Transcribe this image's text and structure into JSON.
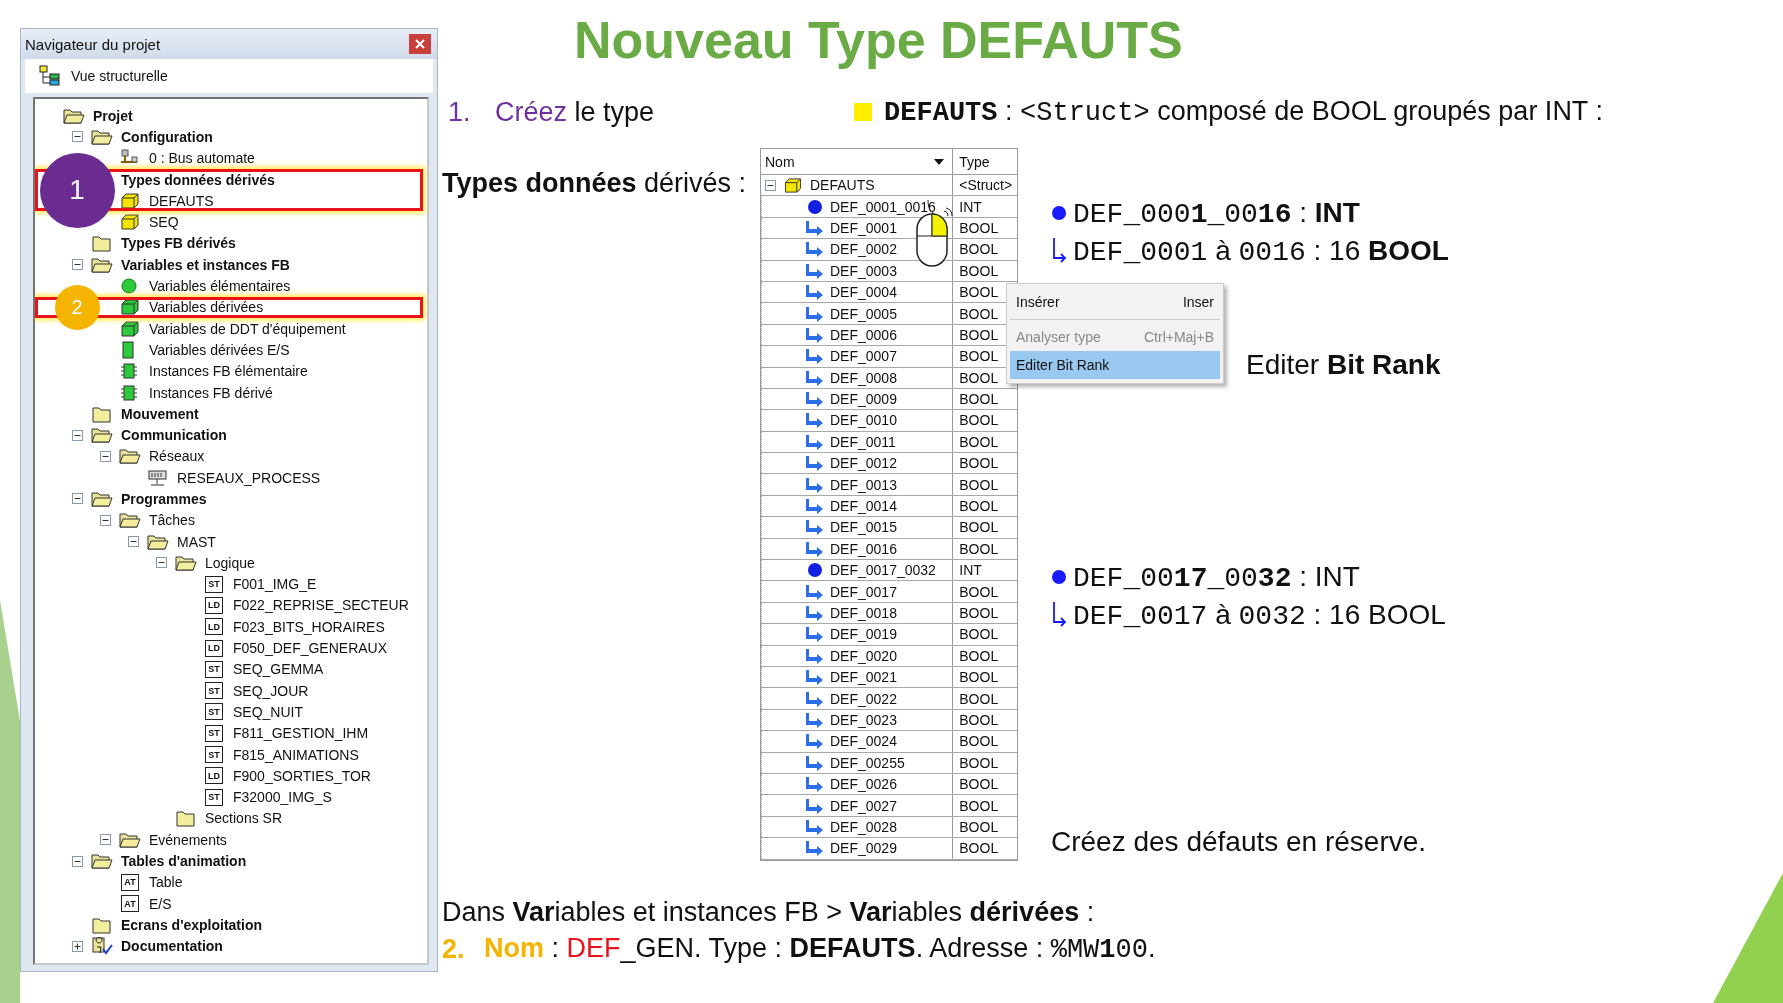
{
  "title": "Nouveau Type DEFAUTS",
  "navigator": {
    "title": "Navigateur du projet",
    "view_label": "Vue structurelle",
    "tree": [
      {
        "label": "Projet",
        "kind": "folder-open",
        "highlighted": false,
        "children": [
          {
            "label": "Configuration",
            "kind": "folder-open",
            "highlighted": false,
            "expanded": true,
            "children": [
              {
                "label": "0 : Bus automate",
                "kind": "bus",
                "highlighted": false
              }
            ]
          },
          {
            "label": "Types données dérivés",
            "highlighted": true,
            "children": [
              {
                "label": "DEFAUTS",
                "kind": "cube-yellow",
                "highlighted": true
              },
              {
                "label": "SEQ",
                "kind": "cube-yellow",
                "highlighted": false
              }
            ]
          },
          {
            "label": "Types FB dérivés",
            "kind": "folder",
            "highlighted": false
          },
          {
            "label": "Variables et instances FB",
            "kind": "folder-open",
            "highlighted": false,
            "expanded": true,
            "children": [
              {
                "label": "Variables élémentaires",
                "kind": "ball-green",
                "highlighted": false
              },
              {
                "label": "Variables dérivées",
                "kind": "cube-green",
                "highlighted": true
              },
              {
                "label": "Variables de DDT d'équipement",
                "kind": "cube-green",
                "highlighted": false
              },
              {
                "label": "Variables dérivées E/S",
                "kind": "block-green",
                "highlighted": false
              },
              {
                "label": "Instances FB élémentaire",
                "kind": "chip-green",
                "highlighted": false
              },
              {
                "label": "Instances FB dérivé",
                "kind": "chip-green",
                "highlighted": false
              }
            ]
          },
          {
            "label": "Mouvement",
            "kind": "folder",
            "highlighted": false
          },
          {
            "label": "Communication",
            "kind": "folder-open",
            "highlighted": false,
            "expanded": true,
            "children": [
              {
                "label": "Réseaux",
                "kind": "folder-open",
                "highlighted": false,
                "expanded": true,
                "children": [
                  {
                    "label": "RESEAUX_PROCESS",
                    "kind": "network",
                    "highlighted": false
                  }
                ]
              }
            ]
          },
          {
            "label": "Programmes",
            "kind": "folder-open",
            "highlighted": false,
            "expanded": true,
            "children": [
              {
                "label": "Tâches",
                "kind": "folder-open",
                "highlighted": false,
                "expanded": true,
                "children": [
                  {
                    "label": "MAST",
                    "kind": "folder-open",
                    "highlighted": false,
                    "expanded": true,
                    "children": [
                      {
                        "label": "Logique",
                        "kind": "folder-open",
                        "highlighted": false,
                        "expanded": true,
                        "children": [
                          {
                            "label": "F001_IMG_E",
                            "kind": "section",
                            "badge": "ST",
                            "highlighted": false
                          },
                          {
                            "label": "F022_REPRISE_SECTEUR",
                            "kind": "section",
                            "badge": "LD",
                            "highlighted": false
                          },
                          {
                            "label": "F023_BITS_HORAIRES",
                            "kind": "section",
                            "badge": "LD",
                            "highlighted": false
                          },
                          {
                            "label": "F050_DEF_GENERAUX",
                            "kind": "section",
                            "badge": "LD",
                            "highlighted": false
                          },
                          {
                            "label": "SEQ_GEMMA",
                            "kind": "section",
                            "badge": "ST",
                            "highlighted": false
                          },
                          {
                            "label": "SEQ_JOUR",
                            "kind": "section",
                            "badge": "ST",
                            "highlighted": false
                          },
                          {
                            "label": "SEQ_NUIT",
                            "kind": "section",
                            "badge": "ST",
                            "highlighted": false
                          },
                          {
                            "label": "F811_GESTION_IHM",
                            "kind": "section",
                            "badge": "ST",
                            "highlighted": false
                          },
                          {
                            "label": "F815_ANIMATIONS",
                            "kind": "section",
                            "badge": "ST",
                            "highlighted": false
                          },
                          {
                            "label": "F900_SORTIES_TOR",
                            "kind": "section",
                            "badge": "LD",
                            "highlighted": false
                          },
                          {
                            "label": "F32000_IMG_S",
                            "kind": "section",
                            "badge": "ST",
                            "highlighted": false
                          }
                        ]
                      },
                      {
                        "label": "Sections SR",
                        "kind": "folder",
                        "highlighted": false
                      }
                    ]
                  }
                ]
              },
              {
                "label": "Evénements",
                "kind": "folder-open",
                "highlighted": false,
                "expanded": true
              }
            ]
          },
          {
            "label": "Tables d'animation",
            "kind": "folder-open",
            "highlighted": false,
            "expanded": true,
            "children": [
              {
                "label": "Table",
                "kind": "section",
                "badge": "AT",
                "highlighted": false
              },
              {
                "label": "E/S",
                "kind": "section",
                "badge": "AT",
                "highlighted": false
              }
            ]
          },
          {
            "label": "Ecrans d'exploitation",
            "kind": "folder",
            "highlighted": false
          },
          {
            "label": "Documentation",
            "kind": "book",
            "highlighted": false,
            "expanded": false
          }
        ]
      }
    ],
    "callouts": [
      {
        "number": "1",
        "color": "#6a2c91"
      },
      {
        "number": "2",
        "color": "#f5b400"
      }
    ]
  },
  "step_1": {
    "number": {
      "text": "1.",
      "kind": "accent"
    },
    "segments": [
      {
        "text": "Créez",
        "kind": "accent"
      },
      {
        "text": " le type",
        "kind": "plain"
      }
    ]
  },
  "type_heading": [
    {
      "text": "DEFAUTS",
      "kind": "monobold"
    },
    {
      "text": " : ",
      "kind": "plain"
    },
    {
      "text": "<Struct>",
      "kind": "mono"
    },
    {
      "text": " composé de BOOL groupés par INT :",
      "kind": "plain"
    }
  ],
  "section_label": [
    {
      "text": "Types données",
      "kind": "bold"
    },
    {
      "text": " dérivés :",
      "kind": "plain"
    }
  ],
  "ddt_table": {
    "columns": [
      "Nom",
      "Type"
    ],
    "root": {
      "name": "DEFAUTS",
      "type": "<Struct>",
      "expanded": true
    },
    "rows": [
      {
        "kind": "int",
        "name": "DEF_0001_0016",
        "type": "INT"
      },
      {
        "kind": "bool",
        "name": "DEF_0001",
        "type": "BOOL"
      },
      {
        "kind": "bool",
        "name": "DEF_0002",
        "type": "BOOL"
      },
      {
        "kind": "bool",
        "name": "DEF_0003",
        "type": "BOOL"
      },
      {
        "kind": "bool",
        "name": "DEF_0004",
        "type": "BOOL"
      },
      {
        "kind": "bool",
        "name": "DEF_0005",
        "type": "BOOL"
      },
      {
        "kind": "bool",
        "name": "DEF_0006",
        "type": "BOOL"
      },
      {
        "kind": "bool",
        "name": "DEF_0007",
        "type": "BOOL"
      },
      {
        "kind": "bool",
        "name": "DEF_0008",
        "type": "BOOL"
      },
      {
        "kind": "bool",
        "name": "DEF_0009",
        "type": "BOOL"
      },
      {
        "kind": "bool",
        "name": "DEF_0010",
        "type": "BOOL"
      },
      {
        "kind": "bool",
        "name": "DEF_0011",
        "type": "BOOL"
      },
      {
        "kind": "bool",
        "name": "DEF_0012",
        "type": "BOOL"
      },
      {
        "kind": "bool",
        "name": "DEF_0013",
        "type": "BOOL"
      },
      {
        "kind": "bool",
        "name": "DEF_0014",
        "type": "BOOL"
      },
      {
        "kind": "bool",
        "name": "DEF_0015",
        "type": "BOOL"
      },
      {
        "kind": "bool",
        "name": "DEF_0016",
        "type": "BOOL"
      },
      {
        "kind": "int",
        "name": "DEF_0017_0032",
        "type": "INT"
      },
      {
        "kind": "bool",
        "name": "DEF_0017",
        "type": "BOOL"
      },
      {
        "kind": "bool",
        "name": "DEF_0018",
        "type": "BOOL"
      },
      {
        "kind": "bool",
        "name": "DEF_0019",
        "type": "BOOL"
      },
      {
        "kind": "bool",
        "name": "DEF_0020",
        "type": "BOOL"
      },
      {
        "kind": "bool",
        "name": "DEF_0021",
        "type": "BOOL"
      },
      {
        "kind": "bool",
        "name": "DEF_0022",
        "type": "BOOL"
      },
      {
        "kind": "bool",
        "name": "DEF_0023",
        "type": "BOOL"
      },
      {
        "kind": "bool",
        "name": "DEF_0024",
        "type": "BOOL"
      },
      {
        "kind": "bool",
        "name": "DEF_00255",
        "type": "BOOL"
      },
      {
        "kind": "bool",
        "name": "DEF_0026",
        "type": "BOOL"
      },
      {
        "kind": "bool",
        "name": "DEF_0027",
        "type": "BOOL"
      },
      {
        "kind": "bool",
        "name": "DEF_0028",
        "type": "BOOL"
      },
      {
        "kind": "bool",
        "name": "DEF_0029",
        "type": "BOOL"
      }
    ]
  },
  "context_menu": [
    {
      "label": "Insérer",
      "shortcut": "Inser",
      "disabled": false,
      "selected": false,
      "separator_after": true
    },
    {
      "label": "Analyser type",
      "shortcut": "Ctrl+Maj+B",
      "disabled": true,
      "selected": false,
      "separator_after": false
    },
    {
      "label": "Editer Bit Rank",
      "disabled": false,
      "selected": true,
      "separator_after": false
    }
  ],
  "notes_first": [
    {
      "kind": "dot",
      "segments": [
        {
          "text": "DEF_000",
          "kind": "mono"
        },
        {
          "text": "1",
          "kind": "monobold"
        },
        {
          "text": "_00",
          "kind": "mono"
        },
        {
          "text": "16",
          "kind": "monobold"
        },
        {
          "text": " : ",
          "kind": "plain"
        },
        {
          "text": "INT",
          "kind": "bold"
        }
      ]
    },
    {
      "kind": "arrow",
      "segments": [
        {
          "text": "DEF_0001",
          "kind": "mono"
        },
        {
          "text": " à ",
          "kind": "plain"
        },
        {
          "text": "0016",
          "kind": "mono"
        },
        {
          "text": " : 16 ",
          "kind": "plain"
        },
        {
          "text": "BOOL",
          "kind": "bold"
        }
      ]
    }
  ],
  "menu_hint": [
    {
      "text": "Editer ",
      "kind": "plain"
    },
    {
      "text": "Bit Rank",
      "kind": "bold"
    }
  ],
  "notes_second": [
    {
      "kind": "dot",
      "segments": [
        {
          "text": "DEF_00",
          "kind": "mono"
        },
        {
          "text": "17",
          "kind": "monobold"
        },
        {
          "text": "_00",
          "kind": "mono"
        },
        {
          "text": "32",
          "kind": "monobold"
        },
        {
          "text": " : INT",
          "kind": "plain"
        }
      ]
    },
    {
      "kind": "arrow",
      "segments": [
        {
          "text": "DEF_0017",
          "kind": "mono"
        },
        {
          "text": " à ",
          "kind": "plain"
        },
        {
          "text": "0032",
          "kind": "mono"
        },
        {
          "text": " : 16 BOOL",
          "kind": "plain"
        }
      ]
    }
  ],
  "reserve_note": [
    {
      "text": "Créez des défauts en réserve.",
      "kind": "plain"
    }
  ],
  "footer_lines": [
    {
      "segments": [
        {
          "text": "Dans ",
          "kind": "plain"
        },
        {
          "text": "Var",
          "kind": "bold"
        },
        {
          "text": "iables et instances FB > ",
          "kind": "plain"
        },
        {
          "text": "Var",
          "kind": "bold"
        },
        {
          "text": "iables ",
          "kind": "plain"
        },
        {
          "text": "dérivées",
          "kind": "bold"
        },
        {
          "text": " :",
          "kind": "plain"
        }
      ]
    },
    {
      "number": {
        "text": "2.",
        "kind": "keyword"
      },
      "segments": [
        {
          "text": "Nom",
          "kind": "keyword"
        },
        {
          "text": " : ",
          "kind": "plain"
        },
        {
          "text": "DEF",
          "kind": "alert"
        },
        {
          "text": "_GEN. Type : ",
          "kind": "plain"
        },
        {
          "text": "DEFAUTS",
          "kind": "bold"
        },
        {
          "text": ". Adresse : ",
          "kind": "plain"
        },
        {
          "text": "%MW",
          "kind": "mono"
        },
        {
          "text": "1",
          "kind": "monobold"
        },
        {
          "text": "00",
          "kind": "mono"
        },
        {
          "text": ".",
          "kind": "plain"
        }
      ]
    }
  ]
}
